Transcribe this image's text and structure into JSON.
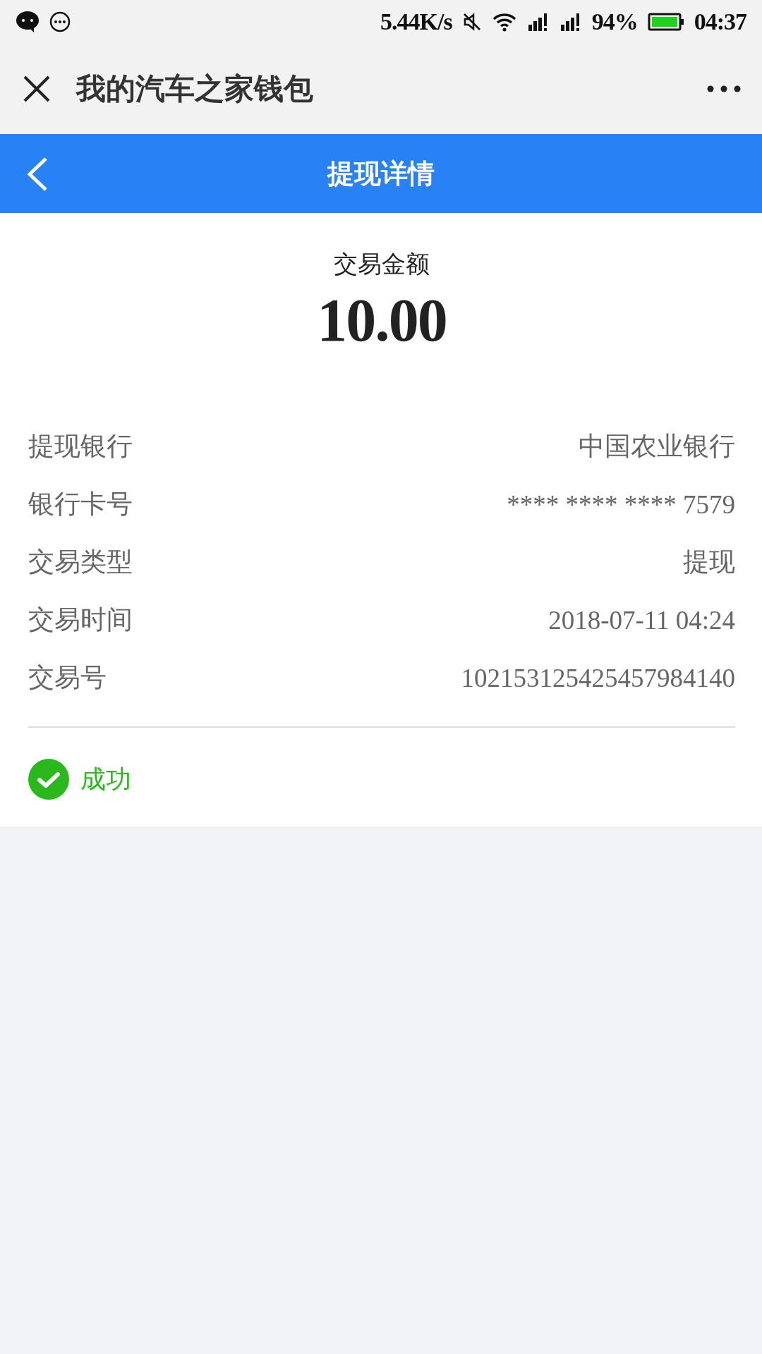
{
  "status_bar": {
    "network_speed": "5.44K/s",
    "battery": "94%",
    "time": "04:37"
  },
  "app_bar": {
    "title": "我的汽车之家钱包"
  },
  "header": {
    "title": "提现详情"
  },
  "amount": {
    "label": "交易金额",
    "value": "10.00"
  },
  "details": [
    {
      "label": "提现银行",
      "value": "中国农业银行"
    },
    {
      "label": "银行卡号",
      "value": "**** **** **** 7579"
    },
    {
      "label": "交易类型",
      "value": "提现"
    },
    {
      "label": "交易时间",
      "value": "2018-07-11 04:24"
    },
    {
      "label": "交易号",
      "value": "102153125425457984140"
    }
  ],
  "status": {
    "kind": "success",
    "text": "成功"
  }
}
